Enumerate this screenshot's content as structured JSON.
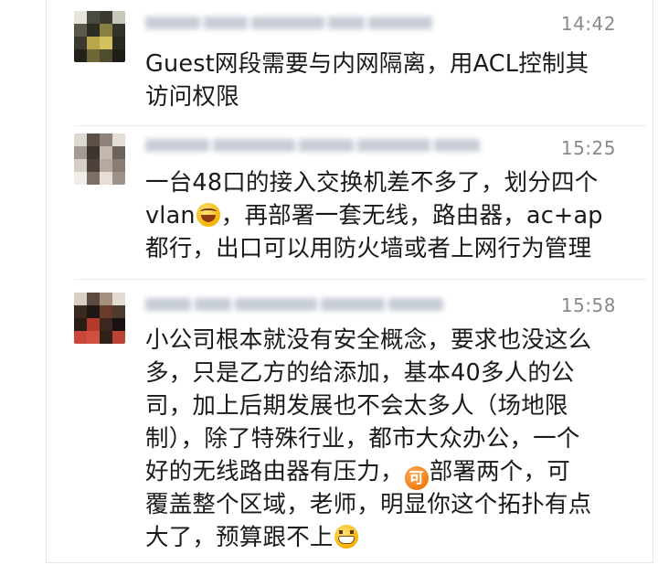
{
  "comments": [
    {
      "time": "14:42",
      "lines": [
        "Guest网段需要与内网隔离，用ACL控制其",
        "访问权限"
      ]
    },
    {
      "time": "15:25",
      "lines": [
        "一台48口的接入交换机差不多了，划分四个"
      ],
      "line2_pre": "vlan",
      "line2_emoji": "laughing-emoji",
      "line2_post": "，再部署一套无线，路由器，ac+ap",
      "line3": "都行，出口可以用防火墙或者上网行为管理"
    },
    {
      "time": "15:58",
      "lines": [
        "小公司根本就没有安全概念，要求也没这么",
        "多，只是乙方的给添加，基本40多人的公",
        "司，加上后期发展也不会太多人（场地限",
        "制），除了特殊行业，都市大众办公，一个"
      ],
      "line5_pre": "好的无线路由器有压力，",
      "line5_emoji": "ke-emoji",
      "line5_emoji_text": "可",
      "line5_post": "部署两个，可",
      "line6": "覆盖整个区域，老师，明显你这个拓扑有点",
      "line7_pre": "大了，预算跟不上",
      "line7_emoji": "grin-emoji"
    }
  ],
  "colors": {
    "timestamp": "#8a8a8a",
    "text": "#1a1a1a",
    "blurred_name": "#c7cdd6"
  }
}
